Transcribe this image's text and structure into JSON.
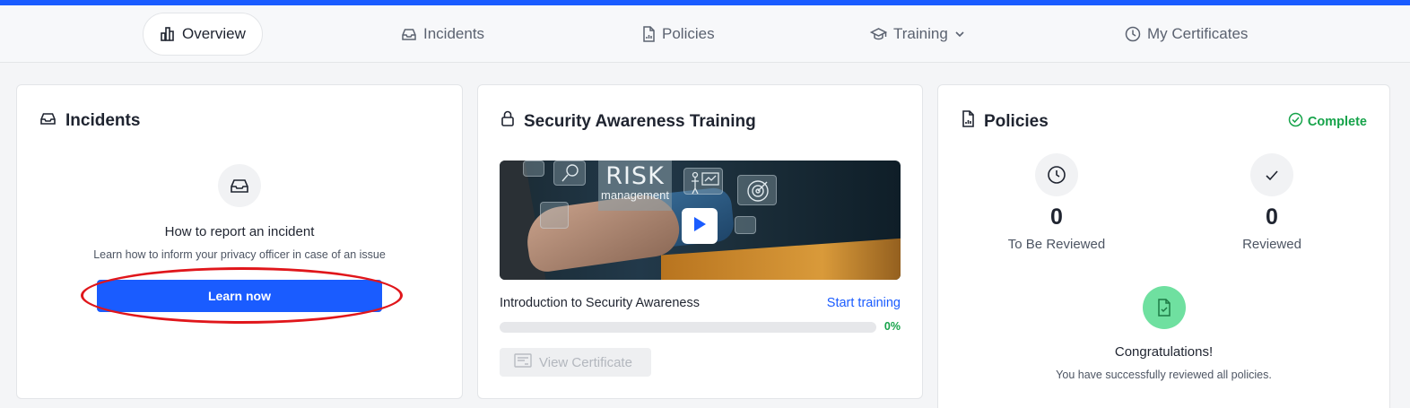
{
  "nav": {
    "items": [
      {
        "label": "Overview",
        "icon": "bar-chart-icon",
        "active": true
      },
      {
        "label": "Incidents",
        "icon": "inbox-icon"
      },
      {
        "label": "Policies",
        "icon": "document-icon"
      },
      {
        "label": "Training",
        "icon": "graduation-cap-icon",
        "has_dropdown": true
      },
      {
        "label": "My Certificates",
        "icon": "clock-icon"
      }
    ]
  },
  "incidents": {
    "title": "Incidents",
    "heading": "How to report an incident",
    "description": "Learn how to inform your privacy officer in case of an issue",
    "button_label": "Learn now"
  },
  "training": {
    "title": "Security Awareness Training",
    "video": {
      "overlay_big": "RISK",
      "overlay_small": "management"
    },
    "course_title": "Introduction to Security Awareness",
    "start_label": "Start training",
    "progress_label": "0%",
    "progress_value": 0,
    "certificate_label": "View Certificate"
  },
  "policies": {
    "title": "Policies",
    "status_label": "Complete",
    "to_be_reviewed": {
      "value": "0",
      "label": "To Be Reviewed"
    },
    "reviewed": {
      "value": "0",
      "label": "Reviewed"
    },
    "congrats_title": "Congratulations!",
    "congrats_text": "You have successfully reviewed all policies."
  },
  "colors": {
    "accent": "#1a5cff",
    "success": "#16a34a",
    "highlight": "#e0161b"
  }
}
